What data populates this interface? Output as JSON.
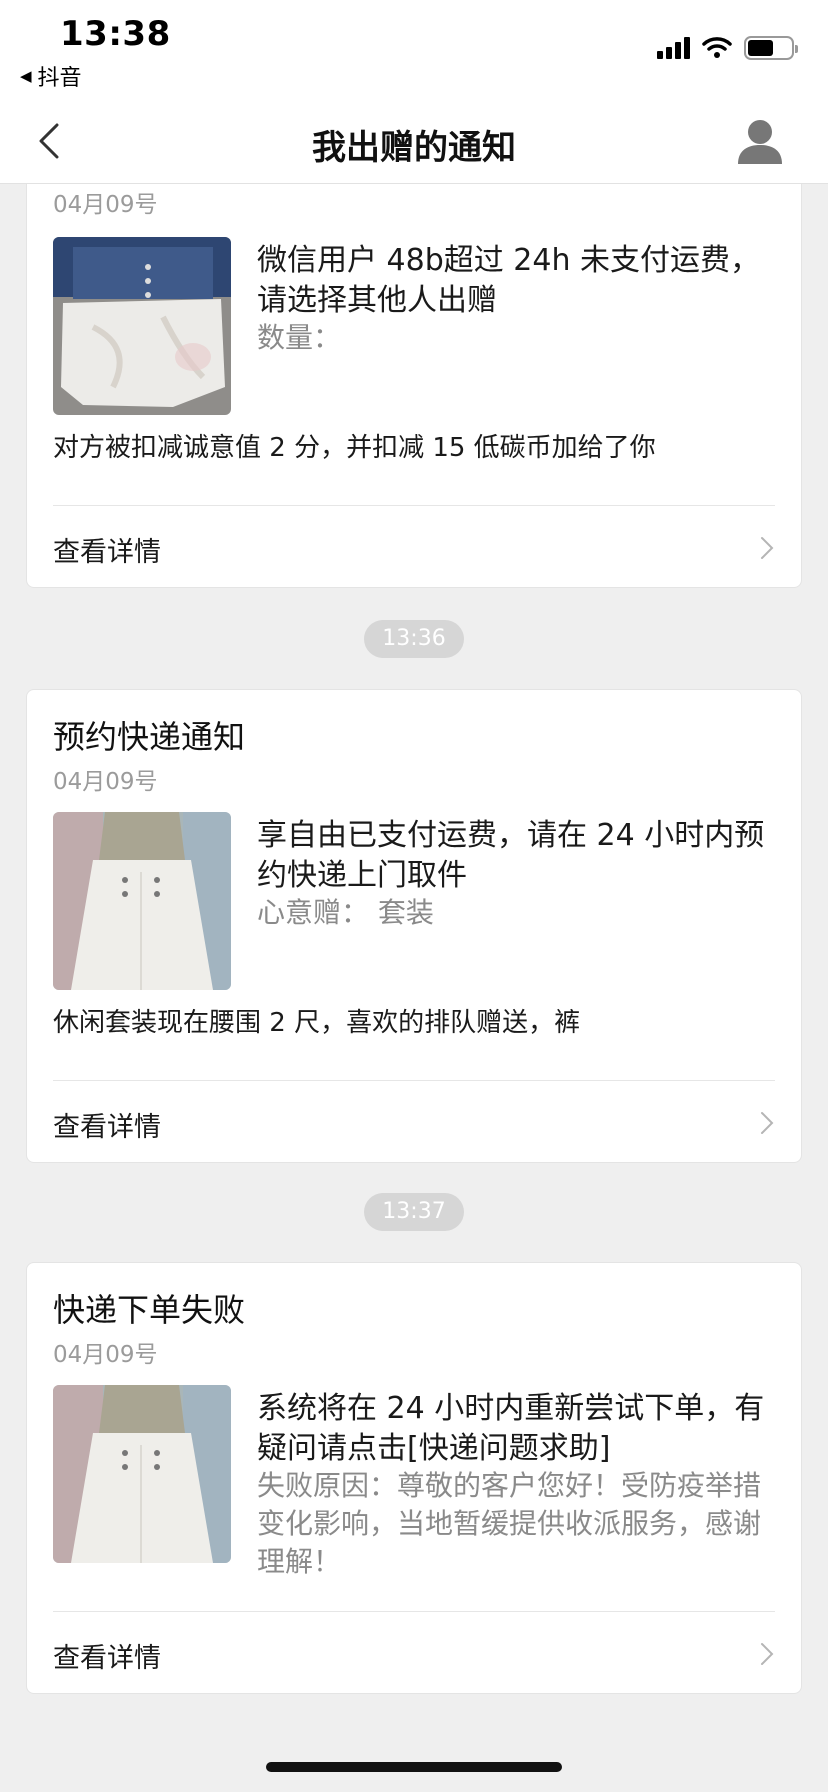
{
  "status_bar": {
    "time": "13:38",
    "back_app": "抖音",
    "back_icon": "back-triangle",
    "battery_level": 0.6
  },
  "nav": {
    "title": "我出赠的通知",
    "back_icon": "chevron-left-icon",
    "user_icon": "user-icon"
  },
  "cards": [
    {
      "title": "",
      "date": "04月09号",
      "main_text": "微信用户 48b超过 24h 未支付运费，请选择其他人出赠",
      "sub_text": "数量：",
      "note": "对方被扣减诚意值 2 分，并扣减 15 低碳币加给了你",
      "detail_label": "查看详情"
    },
    {
      "title": "预约快递通知",
      "date": "04月09号",
      "main_text": "享自由已支付运费，请在 24 小时内预约快递上门取件",
      "sub_text": "心意赠：  套装",
      "note": "休闲套装现在腰围 2 尺，喜欢的排队赠送，裤",
      "detail_label": "查看详情"
    },
    {
      "title": "快递下单失败",
      "date": "04月09号",
      "main_text": "系统将在 24 小时内重新尝试下单，有疑问请点击[快递问题求助]",
      "sub_text": "失败原因：尊敬的客户您好！受防疫举措变化影响，当地暂缓提供收派服务，感谢理解！",
      "note": "",
      "detail_label": "查看详情"
    }
  ],
  "time_pills": [
    "13:36",
    "13:37"
  ],
  "colors": {
    "background": "#efefef",
    "card": "#ffffff",
    "secondary_text": "#9b9b9b",
    "pill": "#d6d6d6"
  }
}
